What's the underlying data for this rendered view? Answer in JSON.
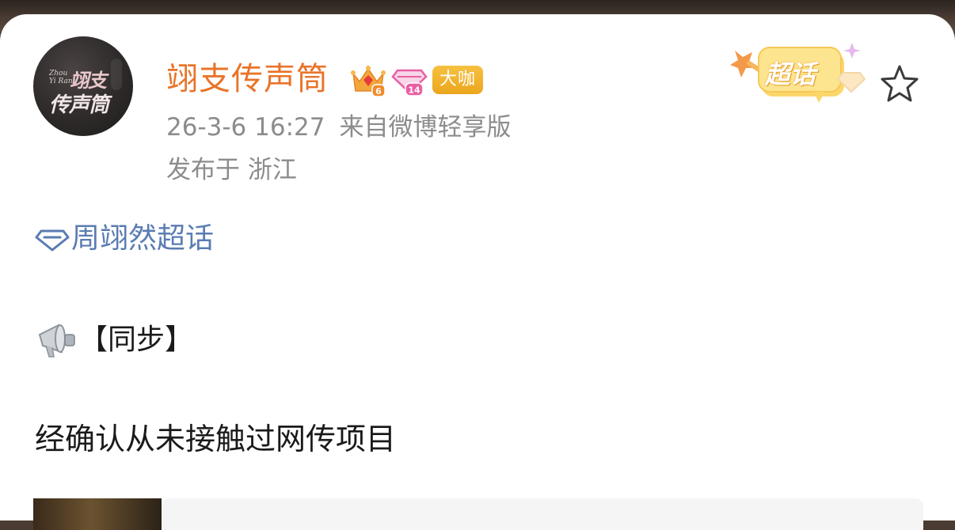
{
  "post": {
    "user": {
      "name": "翊支传声筒",
      "avatar_text": {
        "en": "Zhou Yi Ran",
        "line1": "翊支",
        "line2": "传声筒"
      },
      "badges": {
        "crown_level": "6",
        "diamond_level": "14",
        "tag": "大咖"
      }
    },
    "meta": {
      "time": "26-3-6 16:27",
      "source": "来自微博轻享版",
      "location": "发布于 浙江"
    },
    "sticker_label": "超话",
    "topic": "周翊然超话",
    "sync_label": "【同步】",
    "body": "经确认从未接触过网传项目"
  },
  "colors": {
    "username": "#e8742a",
    "meta": "#8c8c8c",
    "topic_link": "#5a7cb2",
    "text": "#1a1a1a",
    "tag_bg": "#f0b12e"
  },
  "icons": {
    "favorite": "star-outline-icon",
    "topic": "supertopic-diamond-icon",
    "megaphone": "megaphone-icon"
  }
}
